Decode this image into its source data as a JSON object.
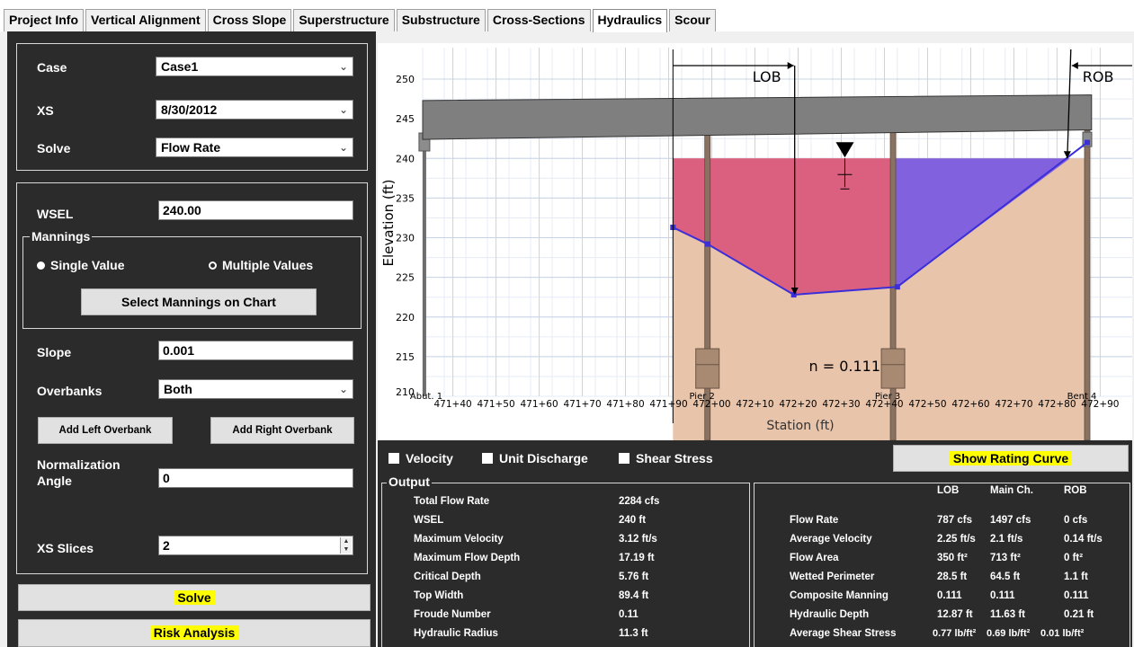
{
  "tabs": [
    "Project Info",
    "Vertical Alignment",
    "Cross Slope",
    "Superstructure",
    "Substructure",
    "Cross-Sections",
    "Hydraulics",
    "Scour"
  ],
  "active_tab": "Hydraulics",
  "left_panel": {
    "case_label": "Case",
    "case_value": "Case1",
    "xs_label": "XS",
    "xs_value": "8/30/2012",
    "solve_label": "Solve",
    "solve_value": "Flow Rate",
    "wsel_label": "WSEL",
    "wsel_value": "240.00",
    "mannings_legend": "Mannings",
    "single_value": "Single Value",
    "multiple_values": "Multiple Values",
    "select_mannings_button": "Select Mannings on Chart",
    "slope_label": "Slope",
    "slope_value": "0.001",
    "overbanks_label": "Overbanks",
    "overbanks_value": "Both",
    "add_left_overbank": "Add Left Overbank",
    "add_right_overbank": "Add Right Overbank",
    "normalization_label_1": "Normalization",
    "normalization_label_2": "Angle",
    "normalization_value": "0",
    "xs_slices_label": "XS Slices",
    "xs_slices_value": "2",
    "solve_button": "Solve",
    "risk_button": "Risk Analysis",
    "highlight_color": "#ffff00"
  },
  "chart_data": {
    "type": "cross-section",
    "xlabel": "Station (ft)",
    "ylabel": "Elevation (ft)",
    "ylim": [
      210,
      252
    ],
    "xlim": [
      47133,
      47292
    ],
    "y_ticks": [
      215,
      220,
      225,
      230,
      235,
      240,
      245,
      250
    ],
    "y_tick_labels": [
      "215",
      "220",
      "225",
      "230",
      "235",
      "240",
      "245",
      "250"
    ],
    "x_ticks": [
      47140,
      47150,
      47160,
      47170,
      47180,
      47190,
      47200,
      47210,
      47220,
      47230,
      47240,
      47250,
      47260,
      47270,
      47280,
      47290
    ],
    "x_tick_labels": [
      "471+40",
      "471+50",
      "471+60",
      "471+70",
      "471+80",
      "471+90",
      "472+00",
      "472+10",
      "472+20",
      "472+30",
      "472+40",
      "472+50",
      "472+60",
      "472+70",
      "472+80",
      "472+90"
    ],
    "y_axis_corner_label": "210",
    "ground_profile": [
      {
        "station": 47191,
        "elevation": 231.3
      },
      {
        "station": 47199,
        "elevation": 229.2
      },
      {
        "station": 47219,
        "elevation": 222.8
      },
      {
        "station": 47243,
        "elevation": 223.8
      },
      {
        "station": 47287,
        "elevation": 242.0
      }
    ],
    "wsel": 240,
    "deck": {
      "left_station": 47133,
      "right_station": 47288,
      "bottom_left": 242.4,
      "bottom_right": 243.6,
      "top_left": 247.3,
      "top_right": 248.0
    },
    "piers": [
      {
        "name": "Abut. 1",
        "station": 47133.4
      },
      {
        "name": "Pier 2",
        "station": 47199
      },
      {
        "name": "Pier 3",
        "station": 47242
      },
      {
        "name": "Bent 4",
        "station": 47287
      }
    ],
    "lob_label": "LOB",
    "rob_label": "ROB",
    "lob_station": 47219,
    "rob_station": 47283,
    "mannings_label": "n = 0.111",
    "colors": {
      "lob_fill": "#d9547a",
      "main_fill": "#7b5cdf",
      "ground_fill": "#e8c4ab",
      "profile": "#3d2fd8",
      "deck": "#7f7f7f",
      "pier": "#8a7262"
    }
  },
  "checkboxes": [
    "Velocity",
    "Unit Discharge",
    "Shear Stress"
  ],
  "show_rating_curve": "Show Rating Curve",
  "output": {
    "legend": "Output",
    "rows": [
      {
        "label": "Total Flow Rate",
        "value": "2284 cfs"
      },
      {
        "label": "WSEL",
        "value": "240 ft"
      },
      {
        "label": "Maximum Velocity",
        "value": "3.12 ft/s"
      },
      {
        "label": "Maximum Flow Depth",
        "value": "17.19 ft"
      },
      {
        "label": "Critical Depth",
        "value": "5.76 ft"
      },
      {
        "label": "Top Width",
        "value": "89.4 ft"
      },
      {
        "label": "Froude Number",
        "value": "0.11"
      },
      {
        "label": "Hydraulic Radius",
        "value": "11.3 ft"
      }
    ],
    "right_headers": [
      "LOB",
      "Main Ch.",
      "ROB"
    ],
    "right_rows": [
      {
        "label": "Flow Rate",
        "values": [
          "787 cfs",
          "1497 cfs",
          "0 cfs"
        ]
      },
      {
        "label": "Average Velocity",
        "values": [
          "2.25 ft/s",
          "2.1 ft/s",
          "0.14 ft/s"
        ]
      },
      {
        "label": "Flow Area",
        "values": [
          "350 ft²",
          "713 ft²",
          "0 ft²"
        ]
      },
      {
        "label": "Wetted Perimeter",
        "values": [
          "28.5 ft",
          "64.5 ft",
          "1.1 ft"
        ]
      },
      {
        "label": "Composite Manning",
        "values": [
          "0.111",
          "0.111",
          "0.111"
        ]
      },
      {
        "label": "Hydraulic Depth",
        "values": [
          "12.87 ft",
          "11.63 ft",
          "0.21 ft"
        ]
      },
      {
        "label": "Average Shear Stress",
        "values": [
          "0.77 lb/ft²",
          "0.69 lb/ft²",
          "0.01 lb/ft²"
        ]
      }
    ]
  }
}
